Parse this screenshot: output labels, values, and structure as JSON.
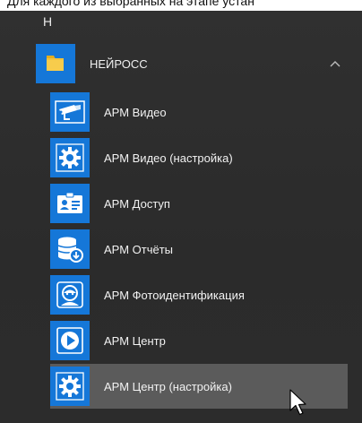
{
  "top_caption": "Для каждого из выбранных на этапе устан",
  "section_letter": "Н",
  "group": {
    "label": "НЕЙРОСС",
    "icon": "folder-icon",
    "expanded": true
  },
  "apps": [
    {
      "label": "АРМ Видео",
      "icon": "camera-icon"
    },
    {
      "label": "АРМ Видео (настройка)",
      "icon": "gear-icon"
    },
    {
      "label": "АРМ Доступ",
      "icon": "id-card-icon"
    },
    {
      "label": "АРМ Отчёты",
      "icon": "database-report-icon"
    },
    {
      "label": "АРМ Фотоидентификация",
      "icon": "face-id-icon"
    },
    {
      "label": "АРМ Центр",
      "icon": "play-circle-icon"
    },
    {
      "label": "АРМ Центр (настройка)",
      "icon": "gear-icon",
      "hovered": true
    }
  ],
  "colors": {
    "tile_blue": "#1577d8",
    "folder_yellow": "#f3c23c",
    "hover_row": "#5b5b5b"
  }
}
